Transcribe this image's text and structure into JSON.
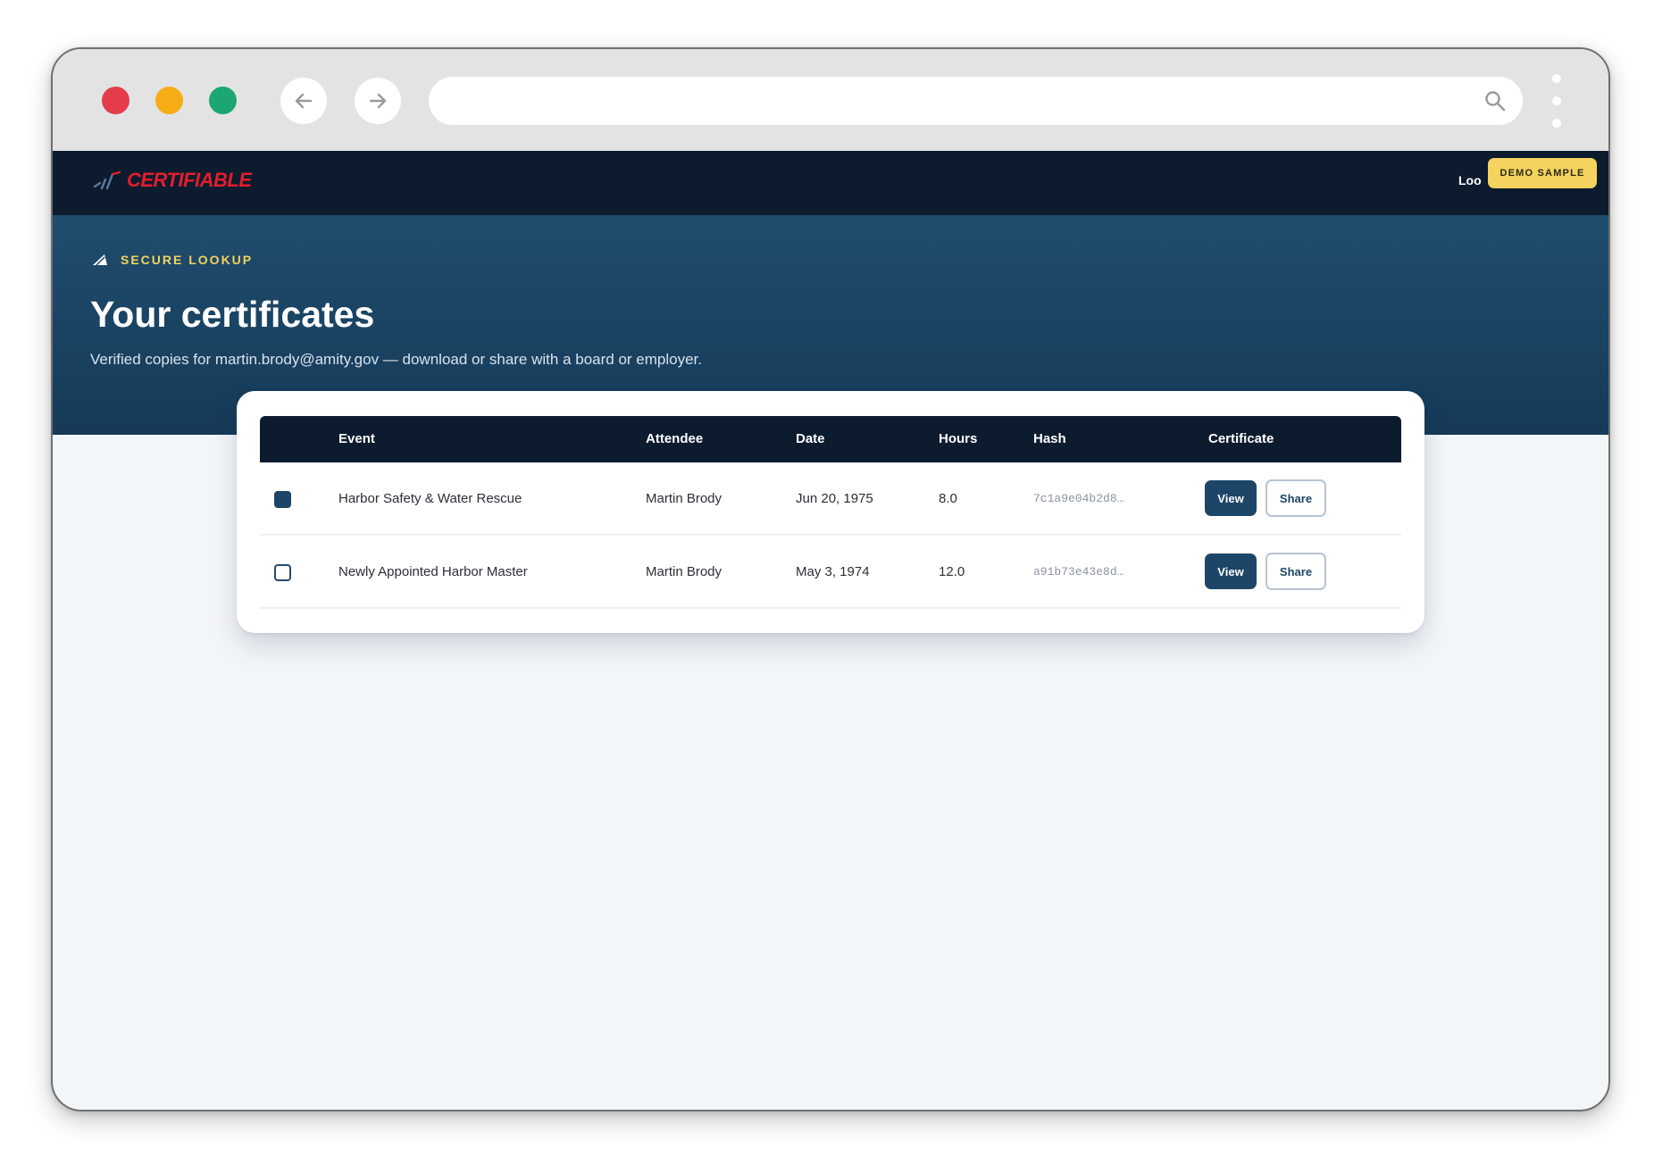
{
  "browser": {
    "url": "",
    "icons": {
      "back": "arrow-left-icon",
      "forward": "arrow-right-icon",
      "search": "search-icon",
      "menu": "kebab-menu-icon"
    }
  },
  "site": {
    "logo_text": "CERTIFIABLE",
    "nav_link": "Loo",
    "demo_badge": "DEMO SAMPLE",
    "colors": {
      "nav": "#0d1b2e",
      "hero": "#1c4566",
      "accent": "#f4d35e",
      "brand_red": "#e21e2c",
      "button": "#1d4567"
    }
  },
  "hero": {
    "eyebrow": "SECURE LOOKUP",
    "title": "Your certificates",
    "subtitle": "Verified copies for martin.brody@amity.gov — download or share with a board or employer."
  },
  "table": {
    "headers": {
      "event": "Event",
      "attendee": "Attendee",
      "date": "Date",
      "hours": "Hours",
      "hash": "Hash",
      "certificate": "Certificate"
    },
    "rows": [
      {
        "checked": true,
        "event": "Harbor Safety & Water Rescue",
        "attendee": "Martin Brody",
        "date": "Jun 20, 1975",
        "hours": "8.0",
        "hash": "7c1a9e04b2d8…",
        "view_label": "View",
        "share_label": "Share"
      },
      {
        "checked": false,
        "event": "Newly Appointed Harbor Master",
        "attendee": "Martin Brody",
        "date": "May 3, 1974",
        "hours": "12.0",
        "hash": "a91b73e43e8d…",
        "view_label": "View",
        "share_label": "Share"
      }
    ]
  }
}
